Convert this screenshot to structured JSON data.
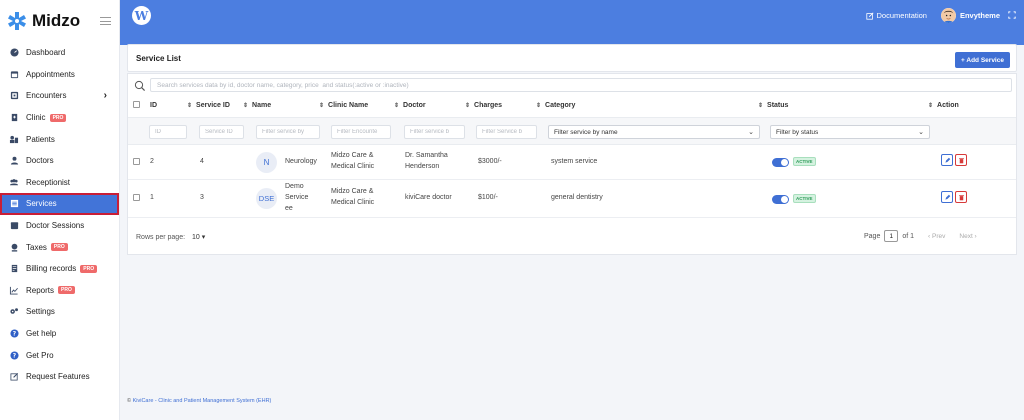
{
  "brand": {
    "name": "Midzo"
  },
  "sidebar": {
    "items": [
      {
        "label": "Dashboard",
        "icon": "dashboard-icon"
      },
      {
        "label": "Appointments",
        "icon": "calendar-icon"
      },
      {
        "label": "Encounters",
        "icon": "encounter-icon",
        "chevron": "›"
      },
      {
        "label": "Clinic",
        "icon": "clinic-icon",
        "badge": "PRO"
      },
      {
        "label": "Patients",
        "icon": "patients-icon"
      },
      {
        "label": "Doctors",
        "icon": "doctor-icon"
      },
      {
        "label": "Receptionist",
        "icon": "receptionist-icon"
      },
      {
        "label": "Services",
        "icon": "services-icon",
        "active": true
      },
      {
        "label": "Doctor Sessions",
        "icon": "sessions-icon"
      },
      {
        "label": "Taxes",
        "icon": "taxes-icon",
        "badge": "PRO"
      },
      {
        "label": "Billing records",
        "icon": "billing-icon",
        "badge": "PRO"
      },
      {
        "label": "Reports",
        "icon": "reports-icon",
        "badge": "PRO"
      },
      {
        "label": "Settings",
        "icon": "settings-icon"
      },
      {
        "label": "Get help",
        "icon": "help-icon"
      },
      {
        "label": "Get Pro",
        "icon": "help-icon"
      },
      {
        "label": "Request Features",
        "icon": "edit-icon"
      }
    ]
  },
  "topbar": {
    "documentation": "Documentation",
    "user": "Envytheme"
  },
  "page": {
    "title": "Service List",
    "add_button": "+ Add Service"
  },
  "search": {
    "placeholder": "Search services data by id, doctor name, category, price  and status(:active or :inactive)"
  },
  "table": {
    "headers": {
      "id": "ID",
      "service_id": "Service ID",
      "name": "Name",
      "clinic": "Clinic Name",
      "doctor": "Doctor",
      "charges": "Charges",
      "category": "Category",
      "status": "Status",
      "action": "Action"
    },
    "filters": {
      "id": "ID",
      "service_id": "Service ID",
      "name": "Filter service by",
      "clinic": "Filter Encounte",
      "doctor": "Filter service b",
      "charges": "Filter Service b",
      "category": "Filter service by name",
      "status": "Filter by status"
    },
    "rows": [
      {
        "id": "2",
        "service_id": "4",
        "initials": "N",
        "name": "Neurology",
        "clinic_1": "Midzo Care &",
        "clinic_2": "Medical Clinic",
        "doctor_1": "Dr. Samantha",
        "doctor_2": "Henderson",
        "charges": "$3000/-",
        "category": "system service",
        "status": "ACTIVE"
      },
      {
        "id": "1",
        "service_id": "3",
        "initials": "DSE",
        "name_1": "Demo",
        "name_2": "Service",
        "name_3": "ee",
        "clinic_1": "Midzo Care &",
        "clinic_2": "Medical Clinic",
        "doctor": "kiviCare doctor",
        "charges": "$100/-",
        "category": "general dentistry",
        "status": "ACTIVE"
      }
    ]
  },
  "pagination": {
    "rows_label": "Rows per page:",
    "rows_value": "10",
    "page_label": "Page",
    "page_value": "1",
    "of_label": "of 1",
    "prev": "‹  Prev",
    "next": "Next  ›"
  },
  "footer": {
    "copy": "©",
    "text": "KiviCare - Clinic and Patient Management System (EHR)"
  },
  "colors": {
    "primary": "#4c7ee0",
    "button": "#3f6fd4",
    "active_outline": "#c91e36",
    "pro_badge": "#ef6a6a"
  }
}
